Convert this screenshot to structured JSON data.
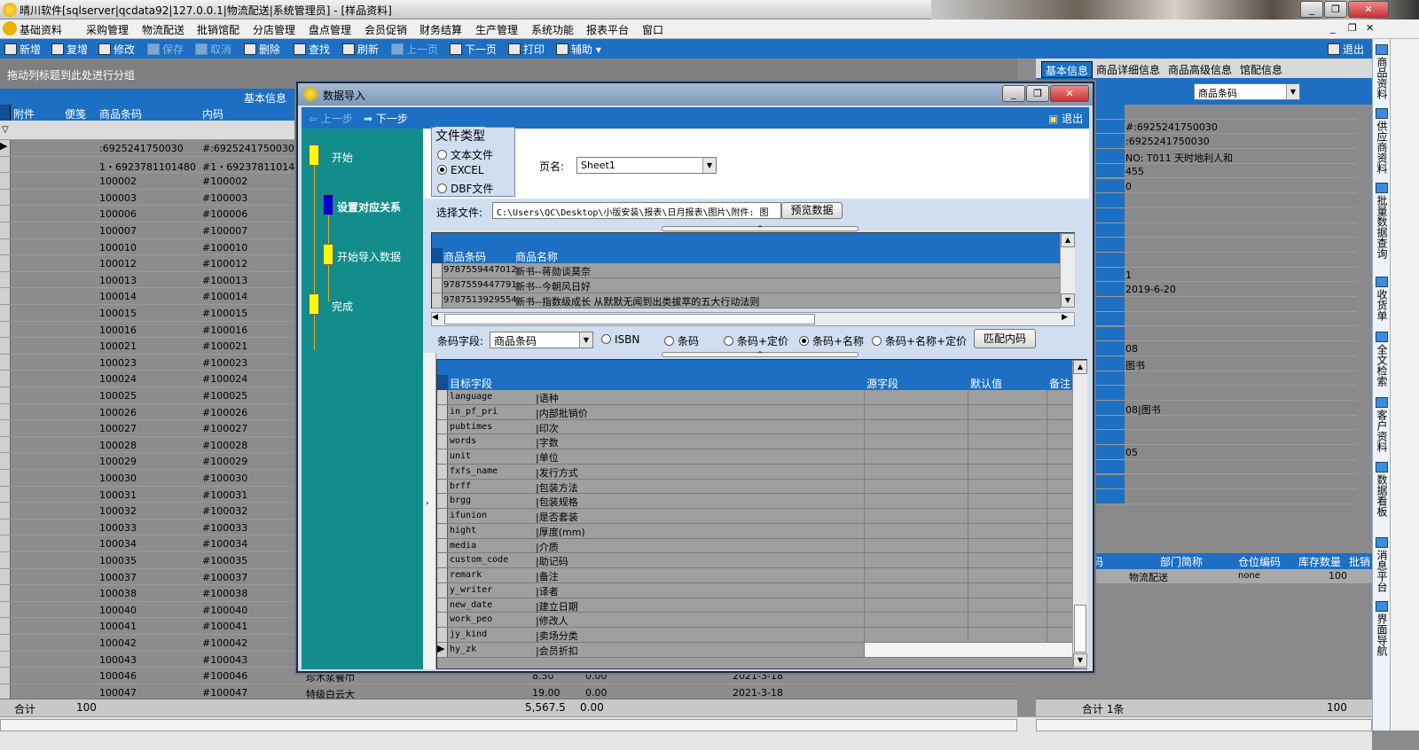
{
  "window": {
    "title": "晴川软件[sqlserver|qcdata92|127.0.0.1|物流配送|系统管理员] - [样品资料]"
  },
  "menu": [
    "基础资料",
    "采购管理",
    "物流配送",
    "批销馆配",
    "分店管理",
    "盘点管理",
    "会员促销",
    "财务结算",
    "生产管理",
    "系统功能",
    "报表平台",
    "窗口"
  ],
  "toolbar": {
    "items": [
      "新增",
      "复增",
      "修改",
      "保存",
      "取消",
      "删除",
      "查找",
      "刷新",
      "上一页",
      "下一页",
      "打印",
      "辅助"
    ],
    "exit": "退出"
  },
  "right_strip": [
    "商品资料",
    "供应商资料",
    "批量数据查询",
    "收货单",
    "全文检索",
    "客户资料",
    "数据看板",
    "消息平台",
    "界面导航"
  ],
  "left": {
    "group_hint": "拖动列标题到此处进行分组",
    "band": "基本信息",
    "columns": [
      "附件",
      "便笺",
      "商品条码",
      "内码"
    ],
    "rows": [
      [
        ":6925241750030",
        "#:6925241750030"
      ],
      [
        "1・6923781101480",
        "#1・6923781101480"
      ],
      [
        "100002",
        "#100002"
      ],
      [
        "100003",
        "#100003"
      ],
      [
        "100006",
        "#100006"
      ],
      [
        "100007",
        "#100007"
      ],
      [
        "100010",
        "#100010"
      ],
      [
        "100012",
        "#100012"
      ],
      [
        "100013",
        "#100013"
      ],
      [
        "100014",
        "#100014"
      ],
      [
        "100015",
        "#100015"
      ],
      [
        "100016",
        "#100016"
      ],
      [
        "100021",
        "#100021"
      ],
      [
        "100023",
        "#100023"
      ],
      [
        "100024",
        "#100024"
      ],
      [
        "100025",
        "#100025"
      ],
      [
        "100026",
        "#100026"
      ],
      [
        "100027",
        "#100027"
      ],
      [
        "100028",
        "#100028"
      ],
      [
        "100029",
        "#100029"
      ],
      [
        "100030",
        "#100030"
      ],
      [
        "100031",
        "#100031"
      ],
      [
        "100032",
        "#100032"
      ],
      [
        "100033",
        "#100033"
      ],
      [
        "100034",
        "#100034"
      ],
      [
        "100035",
        "#100035"
      ],
      [
        "100037",
        "#100037"
      ],
      [
        "100038",
        "#100038"
      ],
      [
        "100040",
        "#100040"
      ],
      [
        "100041",
        "#100041"
      ],
      [
        "100042",
        "#100042"
      ],
      [
        "100043",
        "#100043"
      ],
      [
        "100046",
        "#100046",
        "珍木浆餐巾",
        "8.50",
        "0.00",
        "2021-3-18"
      ],
      [
        "100047",
        "#100047",
        "特级白云大",
        "19.00",
        "0.00",
        "2021-3-18"
      ]
    ],
    "footer": {
      "label": "合计",
      "count": "100",
      "sum1": "5,567.5",
      "sum2": "0.00"
    }
  },
  "right": {
    "tabs": [
      "基本信息",
      "商品详细信息",
      "商品高级信息",
      "馆配信息"
    ],
    "field_select": "商品条码",
    "values": [
      "",
      "#:6925241750030",
      ":6925241750030",
      "NO: T011 天时地利人和",
      "455",
      "0",
      "",
      "",
      "",
      "",
      "",
      "1",
      "2019-6-20",
      "",
      "",
      "",
      "08",
      "图书",
      "",
      "",
      "08|图书",
      "",
      "",
      "05",
      "",
      "",
      ""
    ],
    "table": {
      "headers": [
        "码",
        "部门简称",
        "仓位编码",
        "库存数量",
        "批销"
      ],
      "row": [
        "",
        "物流配送",
        "none",
        "100",
        ""
      ]
    },
    "footer": {
      "label": "合计 1条",
      "value": "100"
    }
  },
  "dialog": {
    "title": "数据导入",
    "prev": "上一步",
    "next": "下一步",
    "exit": "退出",
    "steps": [
      "开始",
      "设置对应关系",
      "开始导入数据",
      "完成"
    ],
    "file_type": {
      "legend": "文件类型",
      "options": [
        "文本文件",
        "EXCEL",
        "DBF文件"
      ],
      "selected": 1
    },
    "page_label": "页名:",
    "page_value": "Sheet1",
    "file_label": "选择文件:",
    "file_value": "C:\\Users\\QC\\Desktop\\小版安装\\报表\\日月报表\\图片\\附件: 图",
    "preview_btn": "预览数据",
    "preview": {
      "headers": [
        "商品条码",
        "商品名称"
      ],
      "rows": [
        [
          "9787559447012",
          "新书--蒋勋谈莫奈"
        ],
        [
          "9787559447791",
          "新书--今朝风日好"
        ],
        [
          "9787513929554",
          "新书--指数级成长 从默默无闻到出类拔萃的五大行动法则"
        ]
      ]
    },
    "barcode_label": "条码字段:",
    "barcode_value": "商品条码",
    "match_options": [
      "ISBN",
      "条码",
      "条码+定价",
      "条码+名称",
      "条码+名称+定价"
    ],
    "match_selected": 3,
    "match_btn": "匹配内码",
    "map_headers": [
      "目标字段",
      "源字段",
      "默认值",
      "备注"
    ],
    "map_rows": [
      [
        "language",
        "|语种"
      ],
      [
        "in_pf_pri",
        "|内部批销价"
      ],
      [
        "pubtimes",
        "|印次"
      ],
      [
        "words",
        "|字数"
      ],
      [
        "unit",
        "|单位"
      ],
      [
        "fxfs_name",
        "|发行方式"
      ],
      [
        "brff",
        "|包装方法"
      ],
      [
        "brgg",
        "|包装规格"
      ],
      [
        "ifunion",
        "|是否套装"
      ],
      [
        "hight",
        "|厚度(mm)"
      ],
      [
        "media",
        "|介质"
      ],
      [
        "custom_code",
        "|助记码"
      ],
      [
        "remark",
        "|备注"
      ],
      [
        "y_writer",
        "|译者"
      ],
      [
        "new_date",
        "|建立日期"
      ],
      [
        "work_peo",
        "|修改人"
      ],
      [
        "jy_kind",
        "|卖场分类"
      ],
      [
        "hy_zk",
        "|会员折扣"
      ]
    ]
  }
}
